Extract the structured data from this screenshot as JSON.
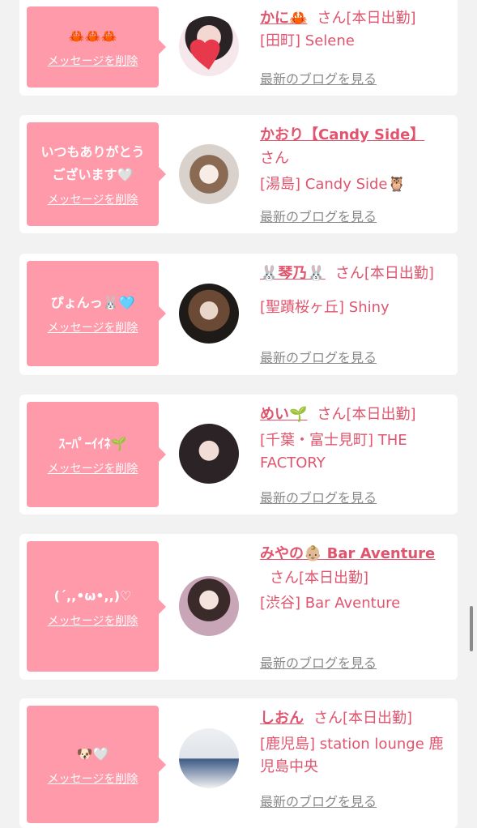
{
  "delete_label": "メッセージを削除",
  "blog_label": "最新のブログを見る",
  "cards": [
    {
      "message": "🦀🦀🦀",
      "name": "かに🦀",
      "suffix": "さん[本日出勤]",
      "shop": "[田町] Selene"
    },
    {
      "message": "いつもありがとう\nございます🤍",
      "name": "かおり【Candy Side】",
      "suffix": "さん",
      "shop": "[湯島] Candy Side🦉"
    },
    {
      "message": "ぴょんっ🐰🩵",
      "name": "🐰琴乃🐰",
      "suffix": "さん[本日出勤]",
      "shop": "[聖蹟桜ヶ丘] Shiny"
    },
    {
      "message": "ｽｰﾊﾟｰｲｲﾈ🌱",
      "name": "めい🌱",
      "suffix": "さん[本日出勤]",
      "shop": "[千葉・富士見町] THE FACTORY"
    },
    {
      "message": "(´,,•ω•,,)♡",
      "name": "みやの👶🏼 Bar Aventure",
      "suffix": "さん[本日出勤]",
      "shop": "[渋谷] Bar Aventure"
    },
    {
      "message": "🐶🤍",
      "name": "しおん",
      "suffix": "さん[本日出勤]",
      "shop": "[鹿児島] station lounge 鹿児島中央"
    }
  ]
}
